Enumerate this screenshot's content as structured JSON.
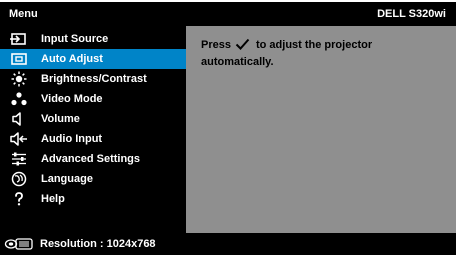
{
  "header": {
    "title": "Menu",
    "model": "DELL S320wi"
  },
  "menu": {
    "items": [
      {
        "label": "Input Source",
        "icon": "input-source-icon",
        "selected": false
      },
      {
        "label": "Auto Adjust",
        "icon": "auto-adjust-icon",
        "selected": true
      },
      {
        "label": "Brightness/Contrast",
        "icon": "brightness-icon",
        "selected": false
      },
      {
        "label": "Video Mode",
        "icon": "video-mode-icon",
        "selected": false
      },
      {
        "label": "Volume",
        "icon": "volume-icon",
        "selected": false
      },
      {
        "label": "Audio Input",
        "icon": "audio-input-icon",
        "selected": false
      },
      {
        "label": "Advanced Settings",
        "icon": "advanced-settings-icon",
        "selected": false
      },
      {
        "label": "Language",
        "icon": "language-icon",
        "selected": false
      },
      {
        "label": "Help",
        "icon": "help-icon",
        "selected": false
      }
    ]
  },
  "content": {
    "line1_before": "Press",
    "line1_after": "to adjust the projector",
    "line2": "automatically."
  },
  "footer": {
    "resolution_label": "Resolution : 1024x768"
  },
  "colors": {
    "background": "#000000",
    "selected": "#0084c8",
    "panel": "#8f8f8f",
    "text": "#ffffff"
  }
}
